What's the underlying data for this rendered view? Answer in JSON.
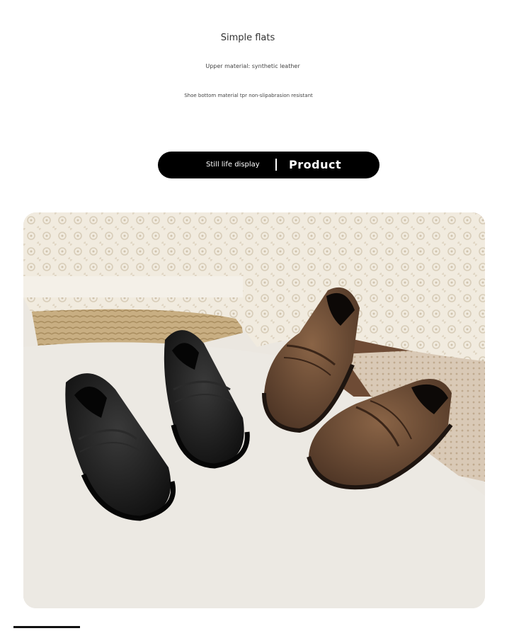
{
  "intro": {
    "headline": "Simple flats",
    "spec_upper": "Upper material: synthetic leather",
    "spec_bottom": "Shoe bottom material tpr non-slipabrasion resistant"
  },
  "section_pill": {
    "left_label": "Still life display",
    "right_label": "Product"
  },
  "photo": {
    "subject": "two pairs of children's loafers, black and brown, on white cloth with lace and wicker basket"
  },
  "colors": {
    "pill_background": "#000000",
    "black_shoe": "#141414",
    "brown_shoe": "#5a3e2b"
  }
}
